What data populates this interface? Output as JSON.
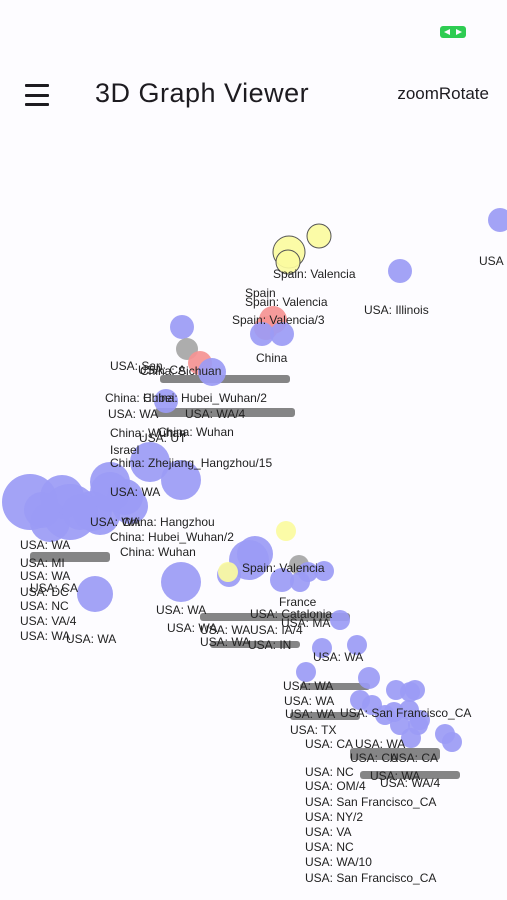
{
  "app_bar": {
    "title": "3D Graph Viewer",
    "mode_label": "zoomRotate"
  },
  "colors": {
    "background": "#fdfcff",
    "node_default": "#9b9bf5",
    "node_pink": "#f59393",
    "node_yellow": "#fbfb9f",
    "node_gray": "#a6a6a6",
    "battery": "#2ecc52"
  },
  "graph": {
    "nodes": [
      {
        "color": "purple",
        "r": 12
      },
      {
        "color": "purple",
        "r": 12
      },
      {
        "color": "yellow",
        "r": 12
      },
      {
        "color": "yellow",
        "r": 16
      },
      {
        "color": "yellow",
        "r": 12
      },
      {
        "color": "pink",
        "r": 14
      },
      {
        "color": "pink",
        "r": 12
      },
      {
        "color": "purple",
        "r": 12
      },
      {
        "color": "purple",
        "r": 12
      },
      {
        "color": "purple",
        "r": 12
      },
      {
        "color": "gray",
        "r": 11
      },
      {
        "color": "pink",
        "r": 12
      },
      {
        "color": "purple",
        "r": 14
      },
      {
        "color": "purple",
        "r": 12
      },
      {
        "color": "purple",
        "r": 20
      },
      {
        "color": "purple",
        "r": 20
      },
      {
        "color": "purple",
        "r": 20
      },
      {
        "color": "purple",
        "r": 18
      },
      {
        "color": "purple",
        "r": 28
      },
      {
        "color": "purple",
        "r": 22
      },
      {
        "color": "purple",
        "r": 28
      },
      {
        "color": "purple",
        "r": 20
      },
      {
        "color": "purple",
        "r": 20
      },
      {
        "color": "purple",
        "r": 18
      },
      {
        "color": "purple",
        "r": 20
      },
      {
        "color": "purple",
        "r": 18
      },
      {
        "color": "purple",
        "r": 18
      },
      {
        "color": "purple",
        "r": 20
      },
      {
        "color": "purple",
        "r": 18
      },
      {
        "color": "yellow",
        "r": 10
      },
      {
        "color": "purple",
        "r": 20
      },
      {
        "color": "purple",
        "r": 12
      },
      {
        "color": "yellow",
        "r": 10
      },
      {
        "color": "gray",
        "r": 10
      },
      {
        "color": "purple",
        "r": 12
      },
      {
        "color": "purple",
        "r": 10
      },
      {
        "color": "purple",
        "r": 10
      },
      {
        "color": "purple",
        "r": 10
      },
      {
        "color": "purple",
        "r": 10
      },
      {
        "color": "purple",
        "r": 20
      },
      {
        "color": "purple",
        "r": 18
      },
      {
        "color": "purple",
        "r": 10
      },
      {
        "color": "purple",
        "r": 10
      },
      {
        "color": "purple",
        "r": 10
      },
      {
        "color": "purple",
        "r": 11
      },
      {
        "color": "purple",
        "r": 10
      },
      {
        "color": "purple",
        "r": 10
      },
      {
        "color": "purple",
        "r": 10
      },
      {
        "color": "purple",
        "r": 10
      },
      {
        "color": "purple",
        "r": 10
      },
      {
        "color": "purple",
        "r": 10
      },
      {
        "color": "purple",
        "r": 10
      },
      {
        "color": "purple",
        "r": 10
      },
      {
        "color": "purple",
        "r": 10
      },
      {
        "color": "purple",
        "r": 10
      },
      {
        "color": "purple",
        "r": 10
      },
      {
        "color": "purple",
        "r": 10
      },
      {
        "color": "purple",
        "r": 10
      },
      {
        "color": "purple",
        "r": 10
      }
    ],
    "labels": [
      "USA",
      "Spain: Valencia",
      "USA: Illinois",
      "Spain",
      "Spain: Valencia",
      "Spain: Valencia/3",
      "China",
      "USA: San",
      "China: Sichuan",
      "China: Hubei",
      "USA: WA",
      "China: Hubei_Wuhan/2",
      "USA: CA",
      "USA: WA/4",
      "China: Wuhan",
      "USA: UT",
      "China: Wuhan",
      "Israel",
      "China: Zhejiang_Hangzhou/15",
      "USA: WA",
      "China: Hangzhou",
      "USA: WA",
      "China: Hubei_Wuhan/2",
      "China: Wuhan",
      "USA: WA",
      "USA: MI",
      "USA: WA",
      "USA: CA",
      "USA: DC",
      "USA: NC",
      "USA: VA/4",
      "USA: WA",
      "USA: WA",
      "Spain: Valencia",
      "USA: WA",
      "France",
      "USA: Catalonia",
      "USA: WA",
      "USA: MA",
      "USA: WA",
      "USA: IA/4",
      "USA: WA",
      "USA: IN",
      "USA: WA",
      "USA: WA",
      "USA: WA",
      "USA: San Francisco_CA",
      "USA: WA",
      "USA: TX",
      "USA: CA",
      "USA: WA",
      "USA: CA",
      "USA: CA",
      "USA: NC",
      "USA: WA",
      "USA: OM/4",
      "USA: WA/4",
      "USA: San Francisco_CA",
      "USA: NY/2",
      "USA: VA",
      "USA: NC",
      "USA: WA/10",
      "USA: San Francisco_CA"
    ]
  }
}
